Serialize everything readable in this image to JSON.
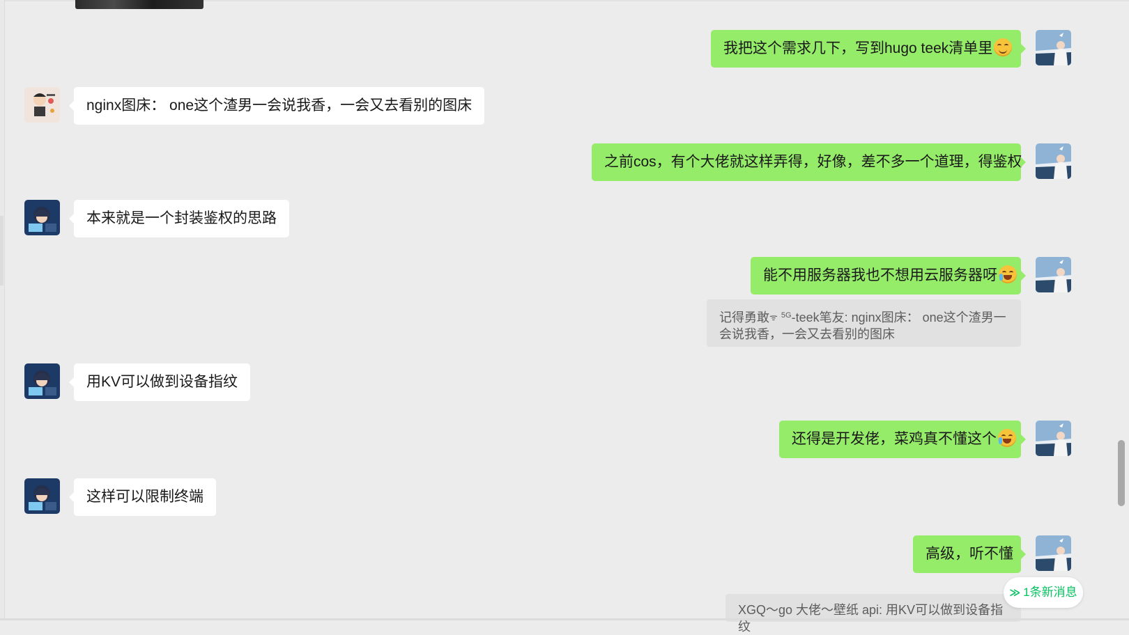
{
  "messages": [
    {
      "side": "out",
      "text": "我把这个需求几下，写到hugo teek清单里",
      "emoji": "smirk-emoji"
    },
    {
      "side": "in",
      "sender_avatar": "cartoon-sticker-avatar",
      "text": "nginx图床： one这个渣男一会说我香，一会又去看别的图床"
    },
    {
      "side": "out",
      "text": "之前cos，有个大佬就这样弄得，好像，差不多一个道理，得鉴权"
    },
    {
      "side": "in",
      "sender_avatar": "anime-coder-avatar",
      "text": "本来就是一个封装鉴权的思路"
    },
    {
      "side": "out",
      "text": "能不用服务器我也不想用云服务器呀",
      "emoji": "laugh-cry-emoji",
      "quote": {
        "name_a": "记得勇敢",
        "name_b": "-teek笔友",
        "text": ": nginx图床： one这个渣男一",
        "text_line2": "会说我香，一会又去看别的图床"
      }
    },
    {
      "side": "in",
      "sender_avatar": "anime-coder-avatar",
      "text": "用KV可以做到设备指纹"
    },
    {
      "side": "out",
      "text": "还得是开发佬，菜鸡真不懂这个",
      "emoji": "laugh-cry-emoji"
    },
    {
      "side": "in",
      "sender_avatar": "anime-coder-avatar",
      "text": "这样可以限制终端"
    },
    {
      "side": "out",
      "text": "高级，听不懂",
      "quote": {
        "text": "XGQ～go 大佬～壁纸 api: 用KV可以做到设备指纹"
      }
    }
  ],
  "quote_glyphs": {
    "wifi": "ᯤ",
    "sup": "5G"
  },
  "new_message_pill": {
    "chevron": "≫",
    "label": "1条新消息",
    "color": "#07c160"
  },
  "colors": {
    "outgoing_bubble": "#95ec69",
    "incoming_bubble": "#ffffff",
    "background": "#ececec"
  }
}
